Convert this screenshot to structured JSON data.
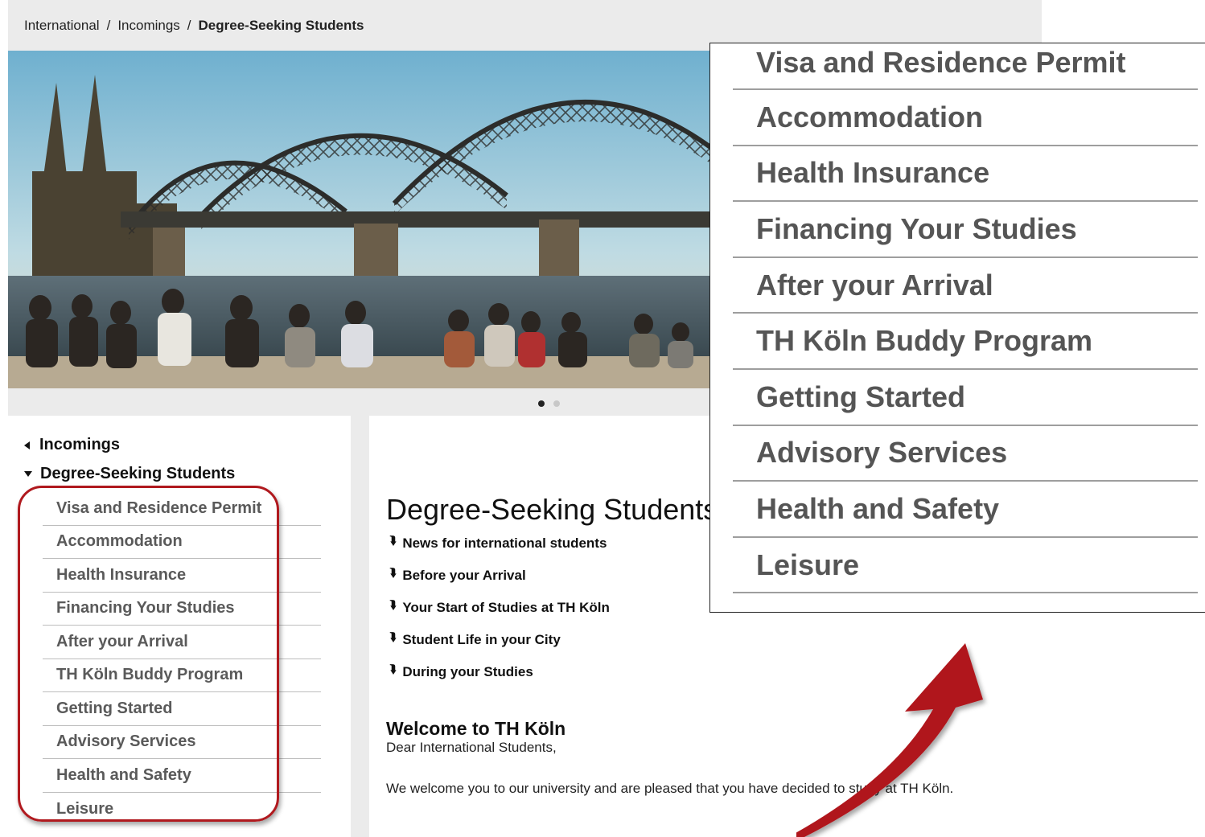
{
  "breadcrumb": {
    "items": [
      "International",
      "Incomings"
    ],
    "separator": "/",
    "current": "Degree-Seeking Students"
  },
  "hero": {
    "image_alt": "Students sitting by the Rhine in front of Hohenzollern Bridge and Cologne Cathedral",
    "prev_icon": "chevron-left-icon",
    "slides_total": 2,
    "active_slide": 1
  },
  "subnav": {
    "parent_label": "Incomings",
    "current_label": "Degree-Seeking Students",
    "items": [
      "Visa and Residence Permit",
      "Accommodation",
      "Health Insurance",
      "Financing Your Studies",
      "After your Arrival",
      "TH Köln Buddy Program",
      "Getting Started",
      "Advisory Services",
      "Health and Safety",
      "Leisure"
    ]
  },
  "main": {
    "title": "Degree-Seeking Students",
    "anchor_icon": "double-chevron-down-icon",
    "anchors": [
      "News for international students",
      "Before your Arrival",
      "Your Start of Studies at TH Köln",
      "Student Life in your City",
      "During your Studies"
    ],
    "welcome_heading": "Welcome to TH Köln",
    "salutation": "Dear International Students,",
    "welcome_text": "We welcome you to our university and are pleased that you have decided to study at TH Köln."
  },
  "colors": {
    "highlight": "#b0191e",
    "breadcrumb_bg": "#ebebeb",
    "nav_text": "#5a5a5a"
  }
}
